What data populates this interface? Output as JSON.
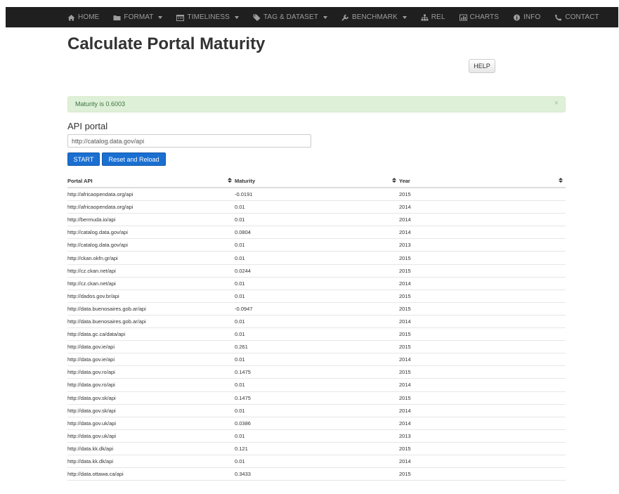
{
  "nav": {
    "items": [
      {
        "key": "home",
        "label": "HOME",
        "icon": "home-icon",
        "dropdown": false
      },
      {
        "key": "format",
        "label": "FORMAT",
        "icon": "folder-icon",
        "dropdown": true
      },
      {
        "key": "timeliness",
        "label": "TIMELINESS",
        "icon": "calendar-icon",
        "dropdown": true
      },
      {
        "key": "tag-dataset",
        "label": "TAG & DATASET",
        "icon": "tag-icon",
        "dropdown": true
      },
      {
        "key": "benchmark",
        "label": "BENCHMARK",
        "icon": "wrench-icon",
        "dropdown": true
      },
      {
        "key": "rel",
        "label": "REL",
        "icon": "sitemap-icon",
        "dropdown": false
      },
      {
        "key": "charts",
        "label": "CHARTS",
        "icon": "chart-icon",
        "dropdown": false
      },
      {
        "key": "info",
        "label": "INFO",
        "icon": "info-icon",
        "dropdown": false
      },
      {
        "key": "contact",
        "label": "CONTACT",
        "icon": "phone-icon",
        "dropdown": false
      }
    ]
  },
  "page": {
    "title": "Calculate Portal Maturity",
    "help_label": "HELP"
  },
  "alert": {
    "text": "Maturity is 0.6003",
    "close": "×"
  },
  "form": {
    "label": "API portal",
    "input_value": "http://catalog.data.gov/api",
    "start_label": "START",
    "reset_label": "Reset and Reload"
  },
  "table": {
    "columns": [
      "Portal API",
      "Maturity",
      "Year"
    ],
    "rows": [
      [
        "http://africaopendata.org/api",
        "-0.0191",
        "2015"
      ],
      [
        "http://africaopendata.org/api",
        "0.01",
        "2014"
      ],
      [
        "http://bermuda.io/api",
        "0.01",
        "2014"
      ],
      [
        "http://catalog.data.gov/api",
        "0.0804",
        "2014"
      ],
      [
        "http://catalog.data.gov/api",
        "0.01",
        "2013"
      ],
      [
        "http://ckan.okfn.gr/api",
        "0.01",
        "2015"
      ],
      [
        "http://cz.ckan.net/api",
        "0.0244",
        "2015"
      ],
      [
        "http://cz.ckan.net/api",
        "0.01",
        "2014"
      ],
      [
        "http://dados.gov.br/api",
        "0.01",
        "2015"
      ],
      [
        "http://data.buenosaires.gob.ar/api",
        "-0.0947",
        "2015"
      ],
      [
        "http://data.buenosaires.gob.ar/api",
        "0.01",
        "2014"
      ],
      [
        "http://data.gc.ca/data/api",
        "0.01",
        "2015"
      ],
      [
        "http://data.gov.ie/api",
        "0.261",
        "2015"
      ],
      [
        "http://data.gov.ie/api",
        "0.01",
        "2014"
      ],
      [
        "http://data.gov.ro/api",
        "0.1475",
        "2015"
      ],
      [
        "http://data.gov.ro/api",
        "0.01",
        "2014"
      ],
      [
        "http://data.gov.sk/api",
        "0.1475",
        "2015"
      ],
      [
        "http://data.gov.sk/api",
        "0.01",
        "2014"
      ],
      [
        "http://data.gov.uk/api",
        "0.0386",
        "2014"
      ],
      [
        "http://data.gov.uk/api",
        "0.01",
        "2013"
      ],
      [
        "http://data.kk.dk/api",
        "0.121",
        "2015"
      ],
      [
        "http://data.kk.dk/api",
        "0.01",
        "2014"
      ],
      [
        "http://data.ottawa.ca/api",
        "0.3433",
        "2015"
      ]
    ]
  },
  "colors": {
    "navbar": "#1f1f1f",
    "nav_text": "#9d9d9d",
    "primary": "#1a6fd1",
    "alert_bg": "#dff0d8",
    "alert_text": "#3c763d"
  }
}
